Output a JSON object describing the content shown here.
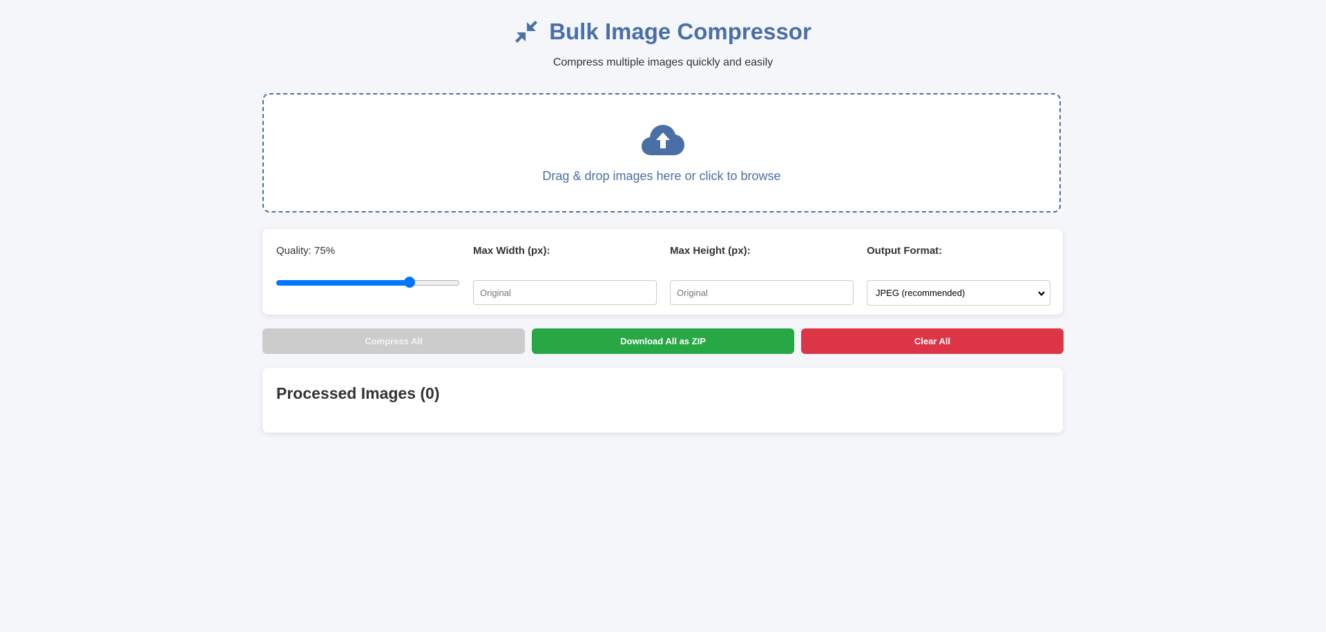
{
  "header": {
    "title": "Bulk Image Compressor",
    "subtitle": "Compress multiple images quickly and easily",
    "icon": "compress-arrows-icon"
  },
  "dropzone": {
    "icon": "cloud-upload-icon",
    "text": "Drag & drop images here or click to browse"
  },
  "settings": {
    "quality": {
      "label": "Quality: 75%",
      "value": 75,
      "min": 0,
      "max": 100
    },
    "max_width": {
      "label": "Max Width (px):",
      "placeholder": "Original"
    },
    "max_height": {
      "label": "Max Height (px):",
      "placeholder": "Original"
    },
    "output_format": {
      "label": "Output Format:",
      "selected": "JPEG (recommended)"
    }
  },
  "actions": {
    "compress_label": "Compress All",
    "download_label": "Download All as ZIP",
    "clear_label": "Clear All"
  },
  "results": {
    "title": "Processed Images (0)"
  },
  "colors": {
    "accent": "#4a6fa5",
    "slider": "#0075ff",
    "download": "#28a745",
    "clear": "#dc3545",
    "disabled": "#cccccc",
    "background": "#f4f6fa"
  }
}
